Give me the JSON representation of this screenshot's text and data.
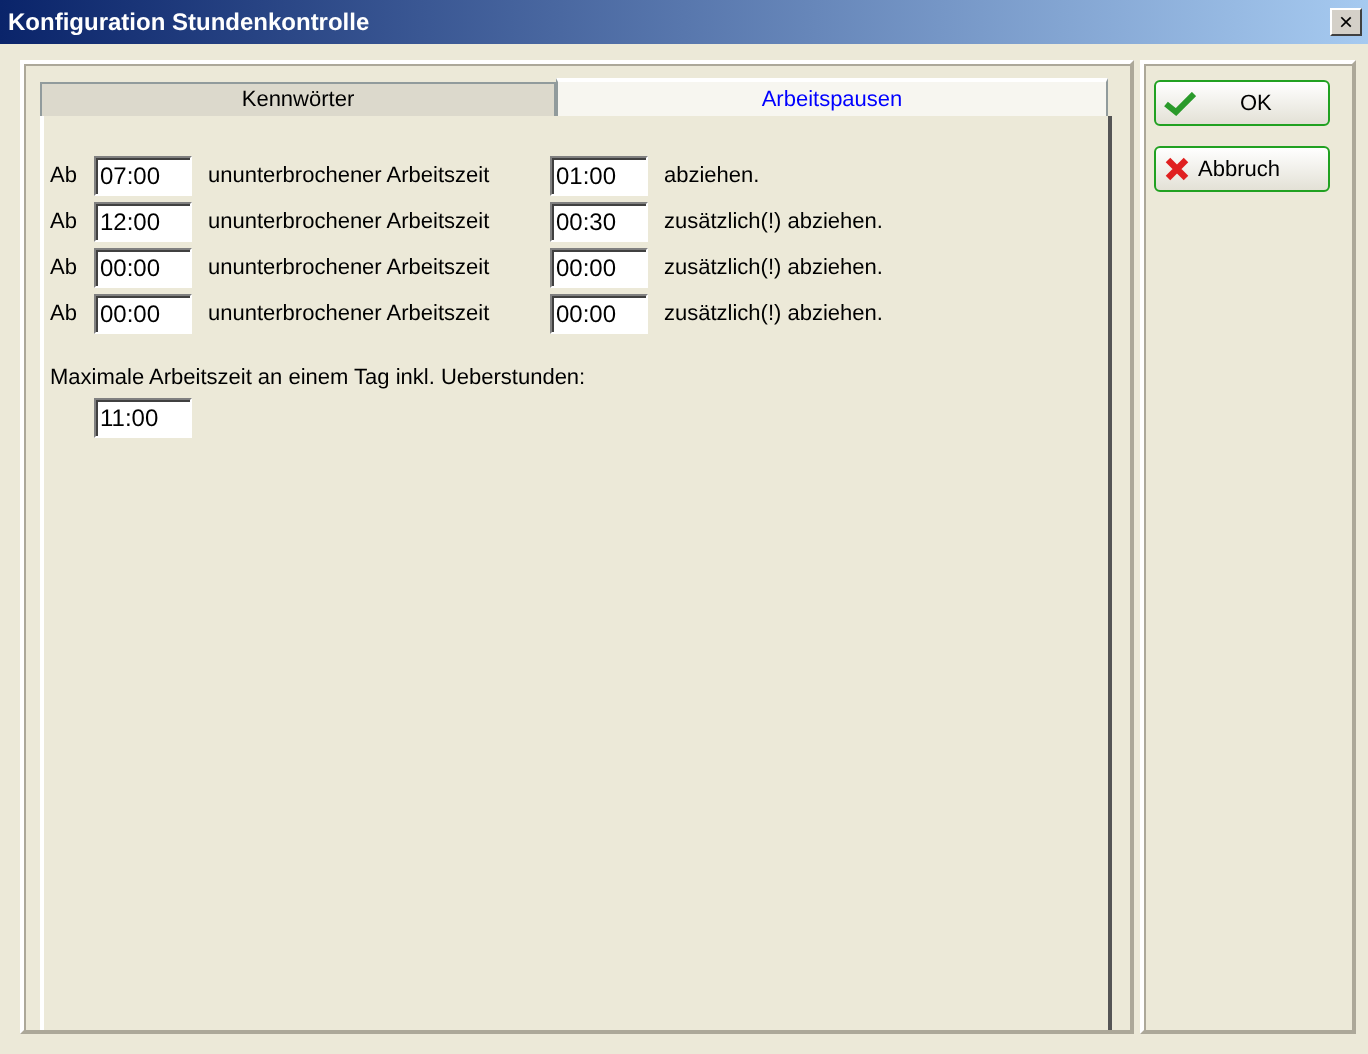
{
  "window": {
    "title": "Konfiguration Stundenkontrolle",
    "close": "×"
  },
  "tabs": [
    {
      "label": "Kennwörter",
      "selected": false
    },
    {
      "label": "Arbeitspausen",
      "selected": true
    }
  ],
  "pauses": [
    {
      "prefix": "Ab",
      "from": "07:00",
      "middle": "ununterbrochener Arbeitszeit",
      "deduct": "01:00",
      "suffix": "abziehen."
    },
    {
      "prefix": "Ab",
      "from": "12:00",
      "middle": "ununterbrochener Arbeitszeit",
      "deduct": "00:30",
      "suffix": "zusätzlich(!) abziehen."
    },
    {
      "prefix": "Ab",
      "from": "00:00",
      "middle": "ununterbrochener Arbeitszeit",
      "deduct": "00:00",
      "suffix": "zusätzlich(!) abziehen."
    },
    {
      "prefix": "Ab",
      "from": "00:00",
      "middle": "ununterbrochener Arbeitszeit",
      "deduct": "00:00",
      "suffix": "zusätzlich(!) abziehen."
    }
  ],
  "max_worktime": {
    "label": "Maximale Arbeitszeit an einem Tag inkl. Ueberstunden:",
    "value": "11:00"
  },
  "buttons": [
    {
      "kind": "ok",
      "label": "OK"
    },
    {
      "kind": "cancel",
      "label": "Abbruch"
    }
  ]
}
